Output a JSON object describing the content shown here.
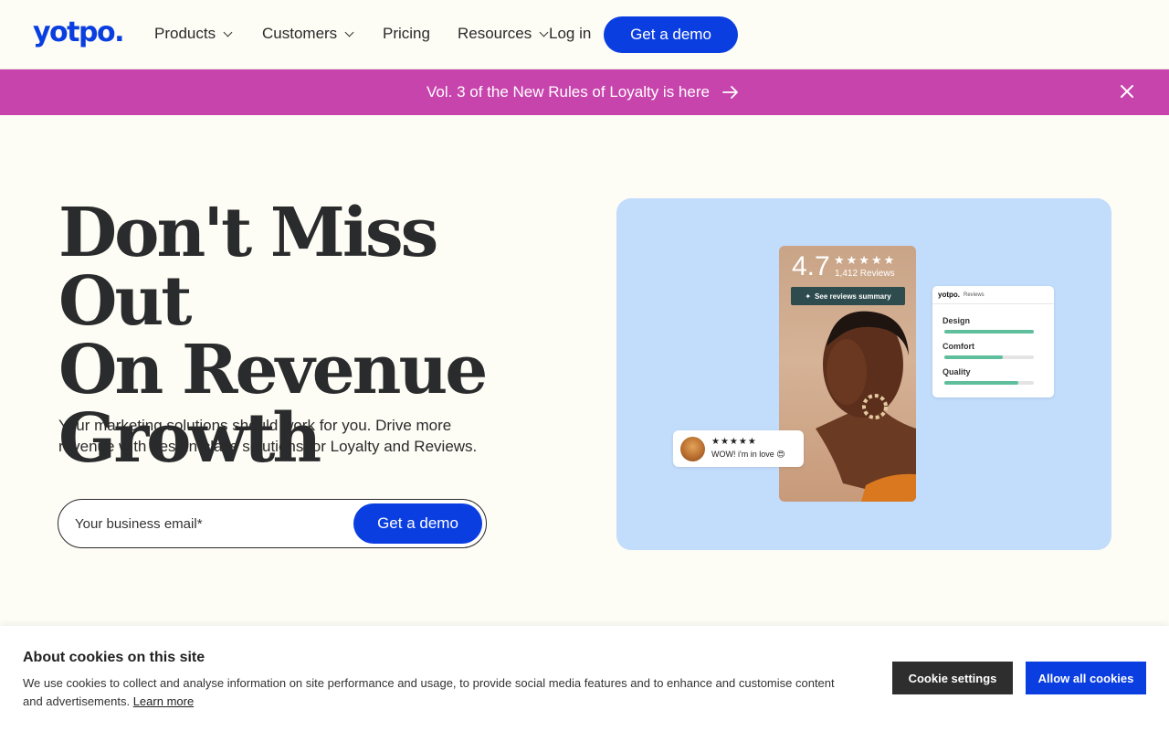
{
  "header": {
    "logo": "yotpo.",
    "nav": [
      {
        "label": "Products",
        "dropdown": true
      },
      {
        "label": "Customers",
        "dropdown": true
      },
      {
        "label": "Pricing",
        "dropdown": false
      },
      {
        "label": "Resources",
        "dropdown": true
      }
    ],
    "login": "Log in",
    "demo_button": "Get a demo"
  },
  "banner": {
    "text": "Vol. 3 of the New Rules of Loyalty is here",
    "color": "#c844ad"
  },
  "hero": {
    "title_lines": [
      "Don't Miss Out",
      "On Revenue",
      "Growth"
    ],
    "subtitle": "Your marketing solutions should work for you. Drive more revenue with best-in-class solutions for Loyalty and Reviews.",
    "email_placeholder": "Your business email*",
    "cta": "Get a demo"
  },
  "hero_image": {
    "rating": "4.7",
    "stars": "★★★★★",
    "review_count": "1,412 Reviews",
    "summary_button": "See reviews summary",
    "reviews_card": {
      "logo": "yotpo.",
      "label": "Reviews",
      "rows": [
        {
          "label": "Design",
          "value": 1.0
        },
        {
          "label": "Comfort",
          "value": 0.65
        },
        {
          "label": "Quality",
          "value": 0.83
        }
      ]
    },
    "review_pill": {
      "stars": "★★★★★",
      "text": "WOW! i'm in love 😍"
    },
    "background": "#c2dcfb"
  },
  "cookies": {
    "title": "About cookies on this site",
    "text": "We use cookies to collect and analyse information on site performance and usage, to provide social media features and to enhance and customise content and advertisements.",
    "learn_more": "Learn more",
    "settings_button": "Cookie settings",
    "allow_button": "Allow all cookies"
  },
  "colors": {
    "brand_blue": "#0a3ee0",
    "page_bg": "#fdfcf5"
  }
}
